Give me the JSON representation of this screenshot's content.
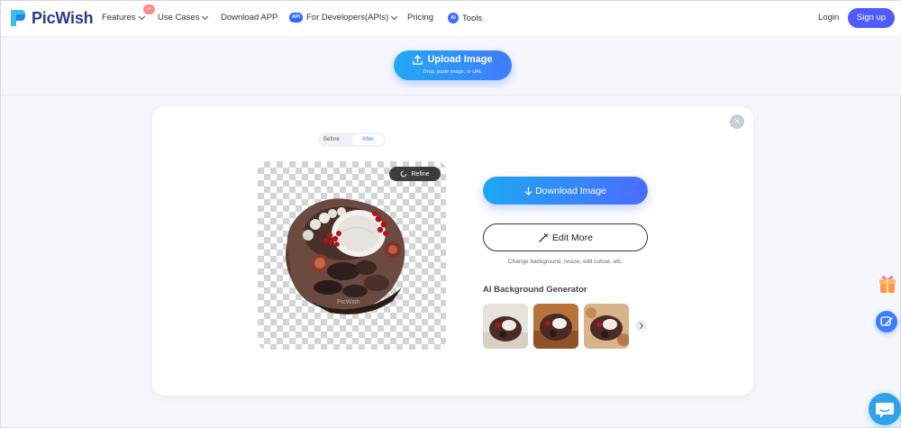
{
  "brand": {
    "name": "PicWish",
    "accent": "#4f5bff"
  },
  "nav": {
    "features": "Features",
    "use_cases": "Use Cases",
    "download_app": "Download APP",
    "api_badge": "API",
    "developers": "For Developers(APIs)",
    "pricing": "Pricing",
    "ai_badge": "AI",
    "tools": "Tools",
    "login": "Login",
    "signup": "Sign up"
  },
  "upload": {
    "label": "Upload Image",
    "hint": "Drop, paste image, or URL"
  },
  "result": {
    "toggle_before": "Before",
    "toggle_after": "After",
    "toggle_selected": "After",
    "refine": "Refine",
    "watermark": "PicWish",
    "download": "Download Image",
    "edit_more": "Edit More",
    "edit_caption": "Change background, resize, edit cutout, etc.",
    "ai_title": "AI Background Generator",
    "thumbnails": [
      "background-option-1",
      "background-option-2",
      "background-option-3"
    ]
  },
  "icons": {
    "close": "close-icon",
    "upload": "upload-icon",
    "download": "download-arrow-icon",
    "edit": "magic-wand-icon",
    "next": "chevron-right-icon",
    "gift": "gift-icon",
    "feedback": "feedback-icon",
    "chat": "chat-icon"
  }
}
